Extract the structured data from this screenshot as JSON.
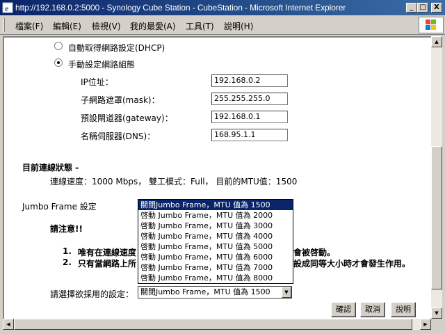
{
  "window": {
    "title": "http://192.168.0.2:5000 - Synology Cube Station - CubeStation - Microsoft Internet Explorer",
    "minimize": "_",
    "maximize": "□",
    "close": "X"
  },
  "menu": {
    "file": "檔案(F)",
    "edit": "編輯(E)",
    "view": "檢視(V)",
    "favorites": "我的最愛(A)",
    "tools": "工具(T)",
    "help": "說明(H)"
  },
  "network": {
    "dhcp_label": "自動取得網路設定(DHCP)",
    "manual_label": "手動設定網路組態",
    "selected_mode": "manual",
    "ip_label": "IP位址：",
    "ip_value": "192.168.0.2",
    "mask_label": "子網路遮罩(mask)：",
    "mask_value": "255.255.255.0",
    "gateway_label": "預設閘道器(gateway)：",
    "gateway_value": "192.168.0.1",
    "dns_label": "名稱伺服器(DNS)：",
    "dns_value": "168.95.1.1"
  },
  "status": {
    "heading": "目前連線狀態 -",
    "line": "連線速度：1000 Mbps， 雙工模式：Full， 目前的MTU值：1500"
  },
  "jumbo": {
    "label": "Jumbo Frame 設定",
    "notice": "請注意!!",
    "note1_num": "1.",
    "note1_left": "唯有在連線速度",
    "note1_right": "會被啓動。",
    "note2_num": "2.",
    "note2_left": "只有當網路上所",
    "note2_right": "設成同等大小時才會發生作用。",
    "select_label": "請選擇欲採用的設定：",
    "selected": "關閉Jumbo Frame，MTU 值為 1500",
    "options": [
      "關閉Jumbo Frame，MTU 值為 1500",
      "啓動 Jumbo Frame，MTU 值為 2000",
      "啓動 Jumbo Frame，MTU 值為 3000",
      "啓動 Jumbo Frame，MTU 值為 4000",
      "啓動 Jumbo Frame，MTU 值為 5000",
      "啓動 Jumbo Frame，MTU 值為 6000",
      "啓動 Jumbo Frame，MTU 值為 7000",
      "啓動 Jumbo Frame，MTU 值為 8000"
    ]
  },
  "buttons": {
    "ok": "確認",
    "cancel": "取消",
    "help": "說明"
  },
  "colors": {
    "titlebar": "#0a246a",
    "selection": "#0a246a"
  }
}
